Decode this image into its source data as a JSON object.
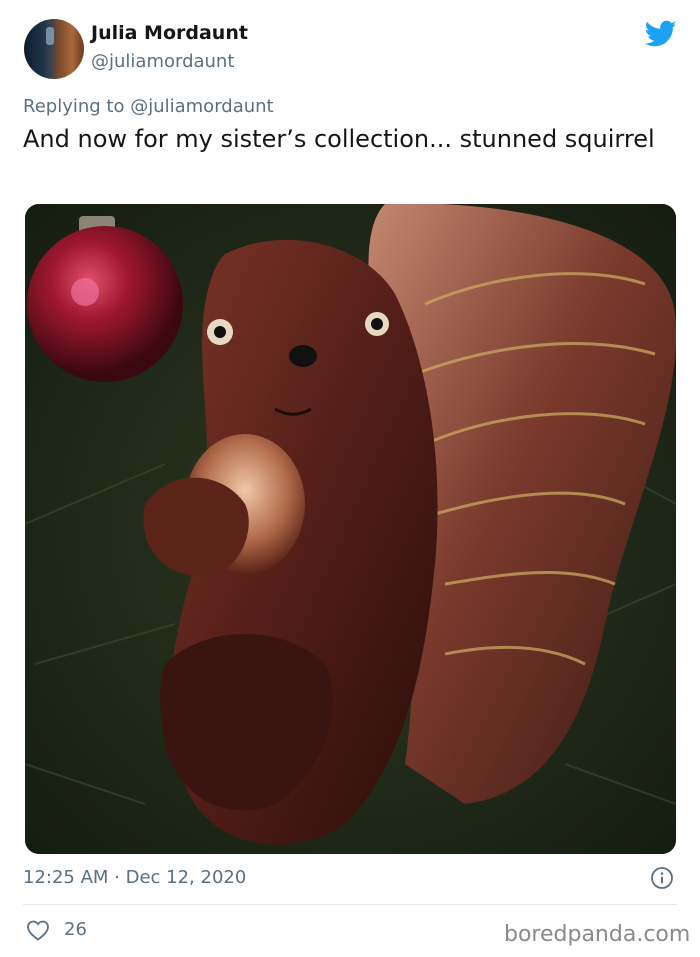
{
  "author": {
    "display_name": "Julia Mordaunt",
    "handle": "@juliamordaunt"
  },
  "reply": {
    "prefix": "Replying to ",
    "handle": "@juliamordaunt"
  },
  "tweet": {
    "text": "And now for my sister’s collection... stunned squirrel"
  },
  "meta": {
    "timestamp": "12:25 AM · Dec 12, 2020"
  },
  "engagement": {
    "likes": "26"
  },
  "watermark": "boredpanda.com",
  "icons": {
    "brand": "twitter-bird-icon",
    "info": "info-icon",
    "like": "heart-icon"
  },
  "colors": {
    "brand_blue": "#1da1f2",
    "secondary_text": "#5b7083"
  }
}
